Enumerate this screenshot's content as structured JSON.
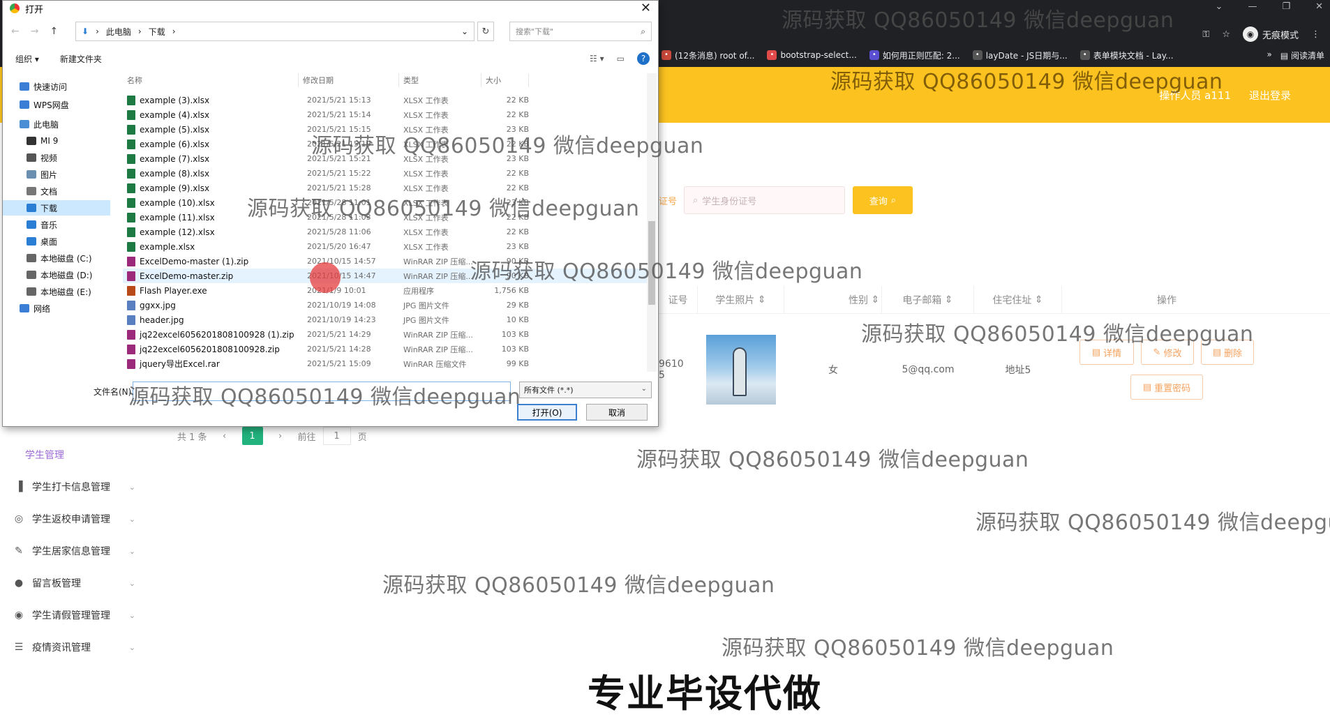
{
  "browser": {
    "incognito_label": "无痕模式",
    "bookmarks": [
      {
        "label": "(12条消息) root of...",
        "color": "#c94a3b"
      },
      {
        "label": "bootstrap-select...",
        "color": "#e34b4b"
      },
      {
        "label": "如何用正则匹配: 2...",
        "color": "#5a4fd1"
      },
      {
        "label": "layDate - JS日期与...",
        "color": "#555"
      },
      {
        "label": "表单模块文档 - Lay...",
        "color": "#555"
      }
    ],
    "reading_list": "阅读清单",
    "more": "»"
  },
  "header": {
    "operator": "操作人员 a111",
    "logout": "退出登录",
    "accent": "#fcc320"
  },
  "search": {
    "label_fragment": "证号",
    "placeholder": "学生身份证号",
    "button": "查询"
  },
  "table": {
    "columns": [
      "证号",
      "学生照片",
      "性别",
      "电子邮箱",
      "住宅住址",
      "操作"
    ],
    "row": {
      "id_fragment": "9610",
      "id_fragment2": "5",
      "gender": "女",
      "email": "5@qq.com",
      "address": "地址5"
    },
    "actions": [
      "详情",
      "修改",
      "删除",
      "重置密码"
    ]
  },
  "pager": {
    "total": "共 1 条",
    "current": "1",
    "goto_label": "前往",
    "goto_value": "1",
    "page_unit": "页"
  },
  "sidebar": {
    "active": "学生管理",
    "items": [
      {
        "label": "学生打卡信息管理",
        "icon": "chart-icon"
      },
      {
        "label": "学生返校申请管理",
        "icon": "settings-icon"
      },
      {
        "label": "学生居家信息管理",
        "icon": "pen-icon"
      },
      {
        "label": "留言板管理",
        "icon": "user-icon"
      },
      {
        "label": "学生请假管理管理",
        "icon": "target-icon"
      },
      {
        "label": "疫情资讯管理",
        "icon": "list-icon"
      }
    ]
  },
  "dialog": {
    "title": "打开",
    "path": [
      "此电脑",
      "下载"
    ],
    "search_placeholder": "搜索\"下载\"",
    "toolbar": {
      "organize": "组织 ▾",
      "new_folder": "新建文件夹"
    },
    "nav": [
      {
        "label": "快速访问",
        "sub": false,
        "color": "#3a7fd5"
      },
      {
        "label": "WPS网盘",
        "sub": false,
        "color": "#3a7fd5"
      },
      {
        "label": "此电脑",
        "sub": false,
        "color": "#4a8fd6"
      },
      {
        "label": "MI 9",
        "sub": true,
        "color": "#333"
      },
      {
        "label": "视频",
        "sub": true,
        "color": "#555"
      },
      {
        "label": "图片",
        "sub": true,
        "color": "#6a8fb0"
      },
      {
        "label": "文档",
        "sub": true,
        "color": "#777"
      },
      {
        "label": "下载",
        "sub": true,
        "color": "#2a7fd5",
        "selected": true
      },
      {
        "label": "音乐",
        "sub": true,
        "color": "#2a7fd5"
      },
      {
        "label": "桌面",
        "sub": true,
        "color": "#2a7fd5"
      },
      {
        "label": "本地磁盘 (C:)",
        "sub": true,
        "color": "#666"
      },
      {
        "label": "本地磁盘 (D:)",
        "sub": true,
        "color": "#666"
      },
      {
        "label": "本地磁盘 (E:)",
        "sub": true,
        "color": "#666"
      },
      {
        "label": "网络",
        "sub": false,
        "color": "#3a7fd5"
      }
    ],
    "columns": [
      "名称",
      "修改日期",
      "类型",
      "大小"
    ],
    "files": [
      {
        "name": "example (3).xlsx",
        "date": "2021/5/21 15:13",
        "type": "XLSX 工作表",
        "size": "22 KB",
        "kind": "xlsx"
      },
      {
        "name": "example (4).xlsx",
        "date": "2021/5/21 15:14",
        "type": "XLSX 工作表",
        "size": "22 KB",
        "kind": "xlsx"
      },
      {
        "name": "example (5).xlsx",
        "date": "2021/5/21 15:15",
        "type": "XLSX 工作表",
        "size": "23 KB",
        "kind": "xlsx"
      },
      {
        "name": "example (6).xlsx",
        "date": "2021/5/21 15:19",
        "type": "XLSX 工作表",
        "size": "22 KB",
        "kind": "xlsx"
      },
      {
        "name": "example (7).xlsx",
        "date": "2021/5/21 15:21",
        "type": "XLSX 工作表",
        "size": "23 KB",
        "kind": "xlsx"
      },
      {
        "name": "example (8).xlsx",
        "date": "2021/5/21 15:22",
        "type": "XLSX 工作表",
        "size": "22 KB",
        "kind": "xlsx"
      },
      {
        "name": "example (9).xlsx",
        "date": "2021/5/21 15:28",
        "type": "XLSX 工作表",
        "size": "22 KB",
        "kind": "xlsx"
      },
      {
        "name": "example (10).xlsx",
        "date": "2021/5/28 11:01",
        "type": "XLSX 工作表",
        "size": "23 KB",
        "kind": "xlsx"
      },
      {
        "name": "example (11).xlsx",
        "date": "2021/5/28 11:03",
        "type": "XLSX 工作表",
        "size": "22 KB",
        "kind": "xlsx"
      },
      {
        "name": "example (12).xlsx",
        "date": "2021/5/28 11:06",
        "type": "XLSX 工作表",
        "size": "22 KB",
        "kind": "xlsx"
      },
      {
        "name": "example.xlsx",
        "date": "2021/5/20 16:47",
        "type": "XLSX 工作表",
        "size": "23 KB",
        "kind": "xlsx"
      },
      {
        "name": "ExcelDemo-master (1).zip",
        "date": "2021/10/15 14:57",
        "type": "WinRAR ZIP 压缩...",
        "size": "90 KB",
        "kind": "zip"
      },
      {
        "name": "ExcelDemo-master.zip",
        "date": "2021/10/15 14:47",
        "type": "WinRAR ZIP 压缩...",
        "size": "90 KB",
        "kind": "zip",
        "hover": true
      },
      {
        "name": "Flash Player.exe",
        "date": "2021/1/9 10:01",
        "type": "应用程序",
        "size": "1,756 KB",
        "kind": "exe"
      },
      {
        "name": "ggxx.jpg",
        "date": "2021/10/19 14:08",
        "type": "JPG 图片文件",
        "size": "29 KB",
        "kind": "jpg"
      },
      {
        "name": "header.jpg",
        "date": "2021/10/19 14:23",
        "type": "JPG 图片文件",
        "size": "10 KB",
        "kind": "jpg"
      },
      {
        "name": "jq22excel6056201808100928 (1).zip",
        "date": "2021/5/21 14:29",
        "type": "WinRAR ZIP 压缩...",
        "size": "103 KB",
        "kind": "zip"
      },
      {
        "name": "jq22excel6056201808100928.zip",
        "date": "2021/5/21 14:28",
        "type": "WinRAR ZIP 压缩...",
        "size": "103 KB",
        "kind": "zip"
      },
      {
        "name": "jquery导出Excel.rar",
        "date": "2021/5/21 15:09",
        "type": "WinRAR 压缩文件",
        "size": "99 KB",
        "kind": "zip"
      }
    ],
    "filename_label": "文件名(N):",
    "filename_value": "",
    "filetype": "所有文件 (*.*)",
    "open_button": "打开(O)",
    "cancel_button": "取消"
  },
  "watermark": "源码获取 QQ86050149 微信deepguan",
  "banner": "专业毕设代做"
}
